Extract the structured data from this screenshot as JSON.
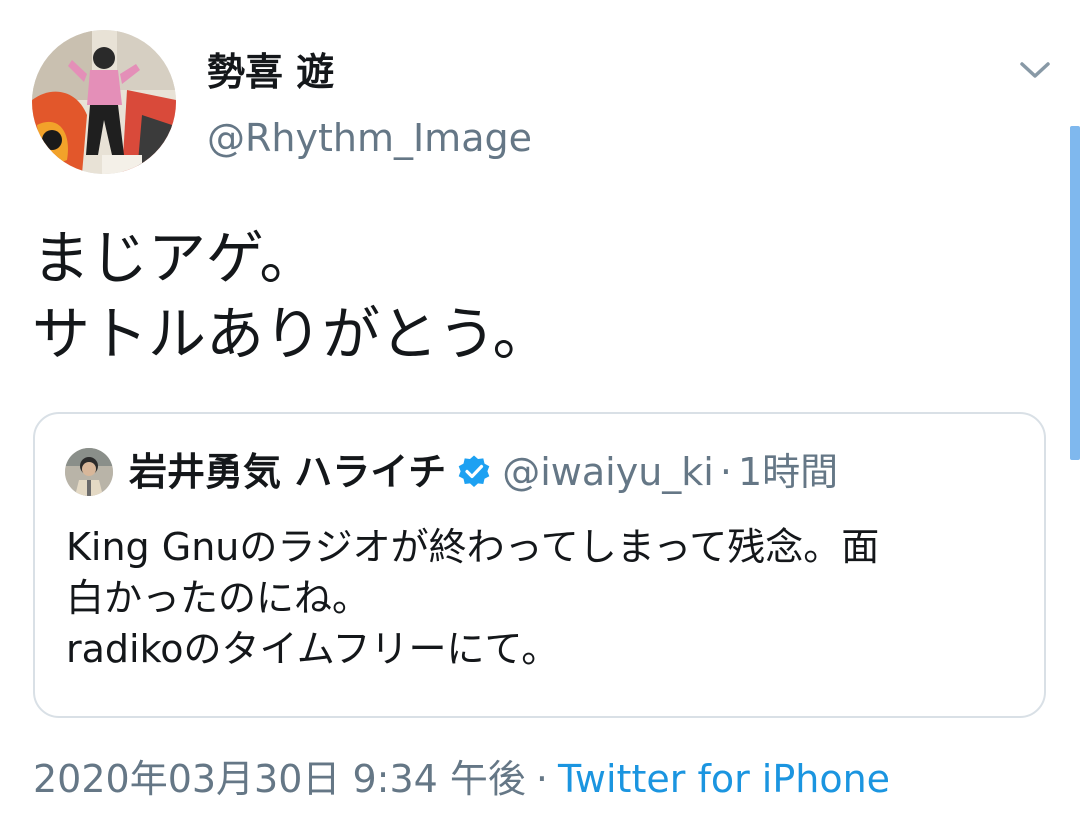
{
  "author": {
    "display_name": "勢喜 遊",
    "handle": "@Rhythm_Image"
  },
  "tweet": {
    "lines": [
      "まじアゲ。",
      "サトルありがとう。"
    ]
  },
  "quoted_tweet": {
    "display_name": "岩井勇気 ハライチ",
    "handle": "@iwaiyu_ki",
    "separator": "·",
    "time": "1時間",
    "lines": [
      "King Gnuのラジオが終わってしまって残念。面",
      "白かったのにね。",
      "radikoのタイムフリーにて。"
    ]
  },
  "meta": {
    "timestamp": "2020年03月30日 9:34 午後",
    "separator": "·",
    "source": "Twitter for iPhone"
  },
  "colors": {
    "link_blue": "#1b95e0",
    "secondary_text": "#657786",
    "border": "#d9e0e6",
    "scrollbar": "#7fb8ee"
  },
  "icons": [
    "chevron-down-icon",
    "verified-badge-icon"
  ]
}
